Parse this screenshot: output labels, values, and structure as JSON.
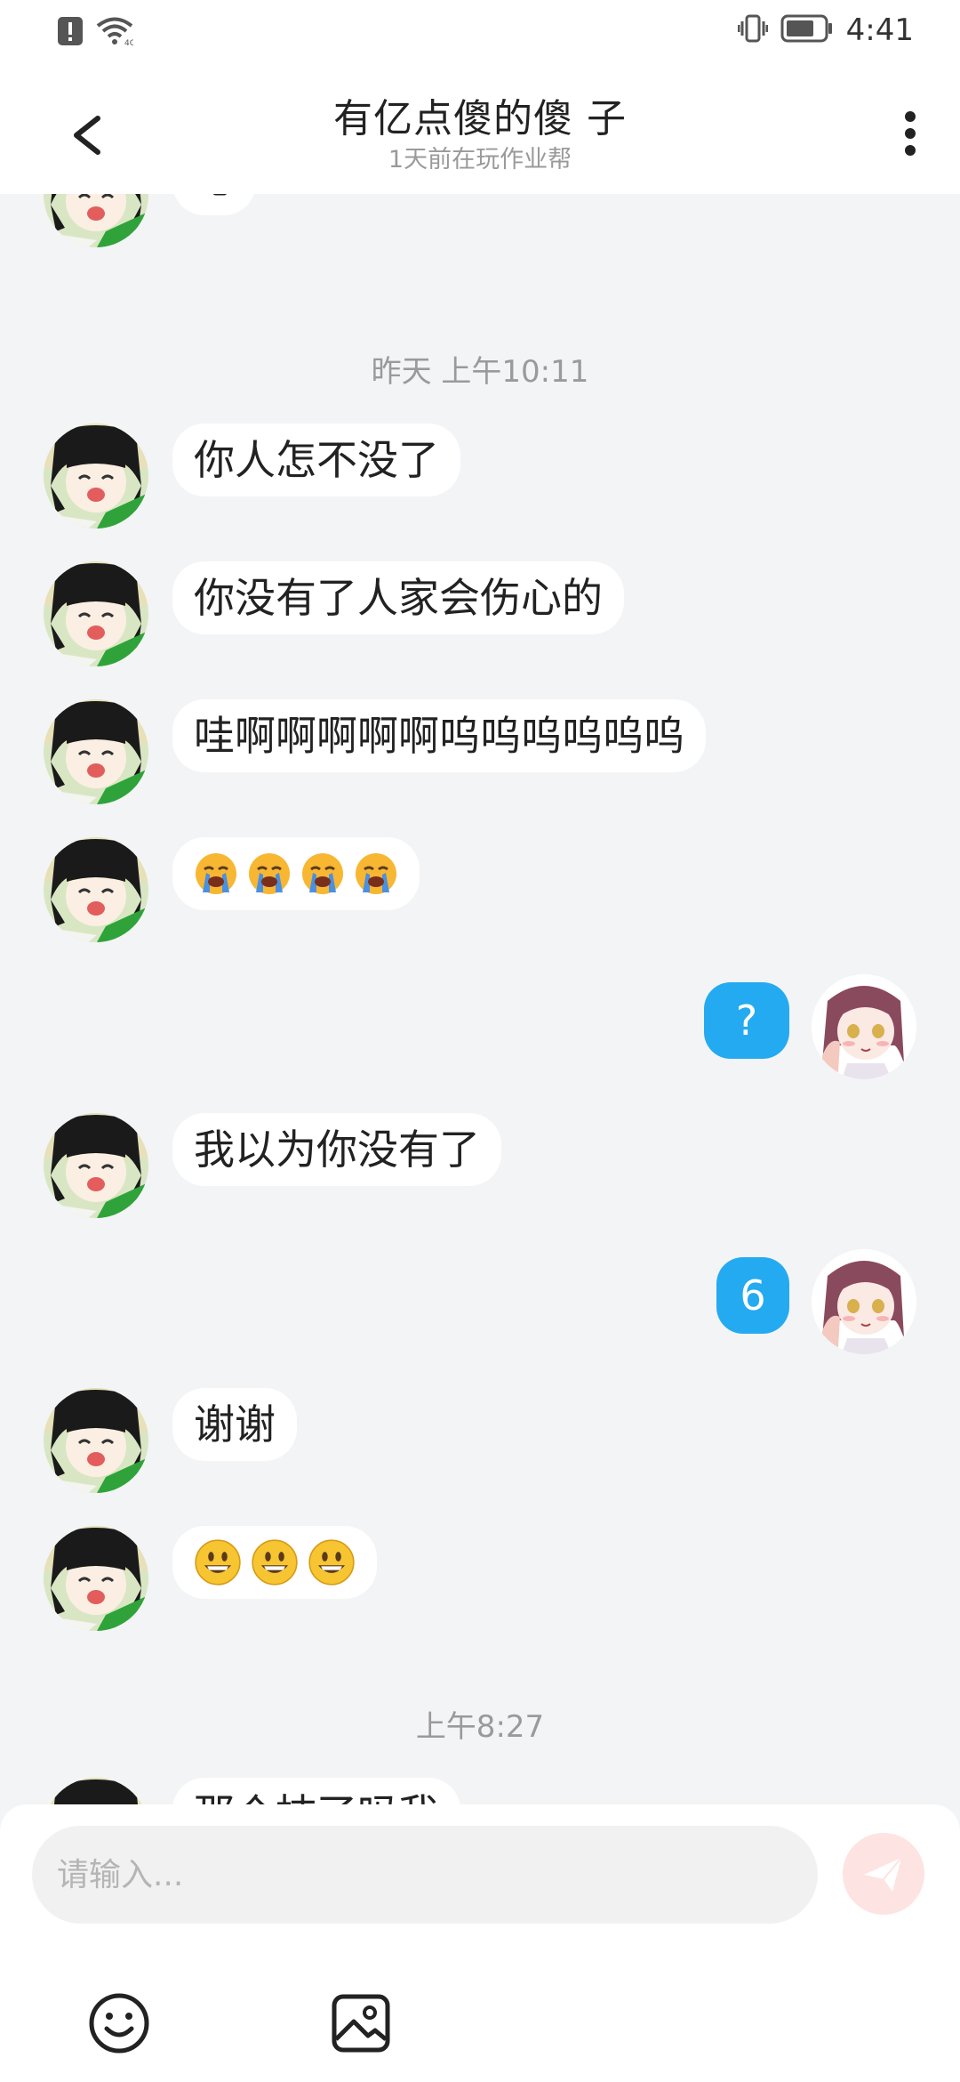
{
  "status_bar": {
    "time": "4:41",
    "icons": [
      "alert-icon",
      "wifi-icon",
      "vibrate-icon",
      "battery-icon"
    ]
  },
  "header": {
    "title": "有亿点傻的傻  子",
    "subtitle": "1天前在玩作业帮",
    "back_icon": "back-chevron-icon",
    "more_icon": "more-vertical-icon"
  },
  "messages": [
    {
      "side": "in",
      "text": "嗯"
    },
    {
      "type": "timestamp",
      "text": "昨天 上午10:11"
    },
    {
      "side": "in",
      "text": "你人怎不没了"
    },
    {
      "side": "in",
      "text": "你没有了人家会伤心的"
    },
    {
      "side": "in",
      "text": "哇啊啊啊啊啊呜呜呜呜呜呜"
    },
    {
      "side": "in",
      "emoji": [
        "loudly-crying-face",
        "loudly-crying-face",
        "loudly-crying-face",
        "loudly-crying-face"
      ]
    },
    {
      "side": "out",
      "text": "?"
    },
    {
      "side": "in",
      "text": "我以为你没有了"
    },
    {
      "side": "out",
      "text": "6"
    },
    {
      "side": "in",
      "text": "谢谢"
    },
    {
      "side": "in",
      "emoji": [
        "grinning-face",
        "grinning-face",
        "grinning-face"
      ]
    },
    {
      "type": "timestamp",
      "text": "上午8:27"
    },
    {
      "side": "in",
      "text": "那个抹了吗我"
    }
  ],
  "input": {
    "placeholder": "请输入...",
    "send_icon": "send-icon",
    "tools": [
      "emoji-icon",
      "image-icon"
    ]
  },
  "colors": {
    "out_bubble": "#24aaf0",
    "background": "#f3f4f6",
    "send_button": "#fde3e1"
  }
}
